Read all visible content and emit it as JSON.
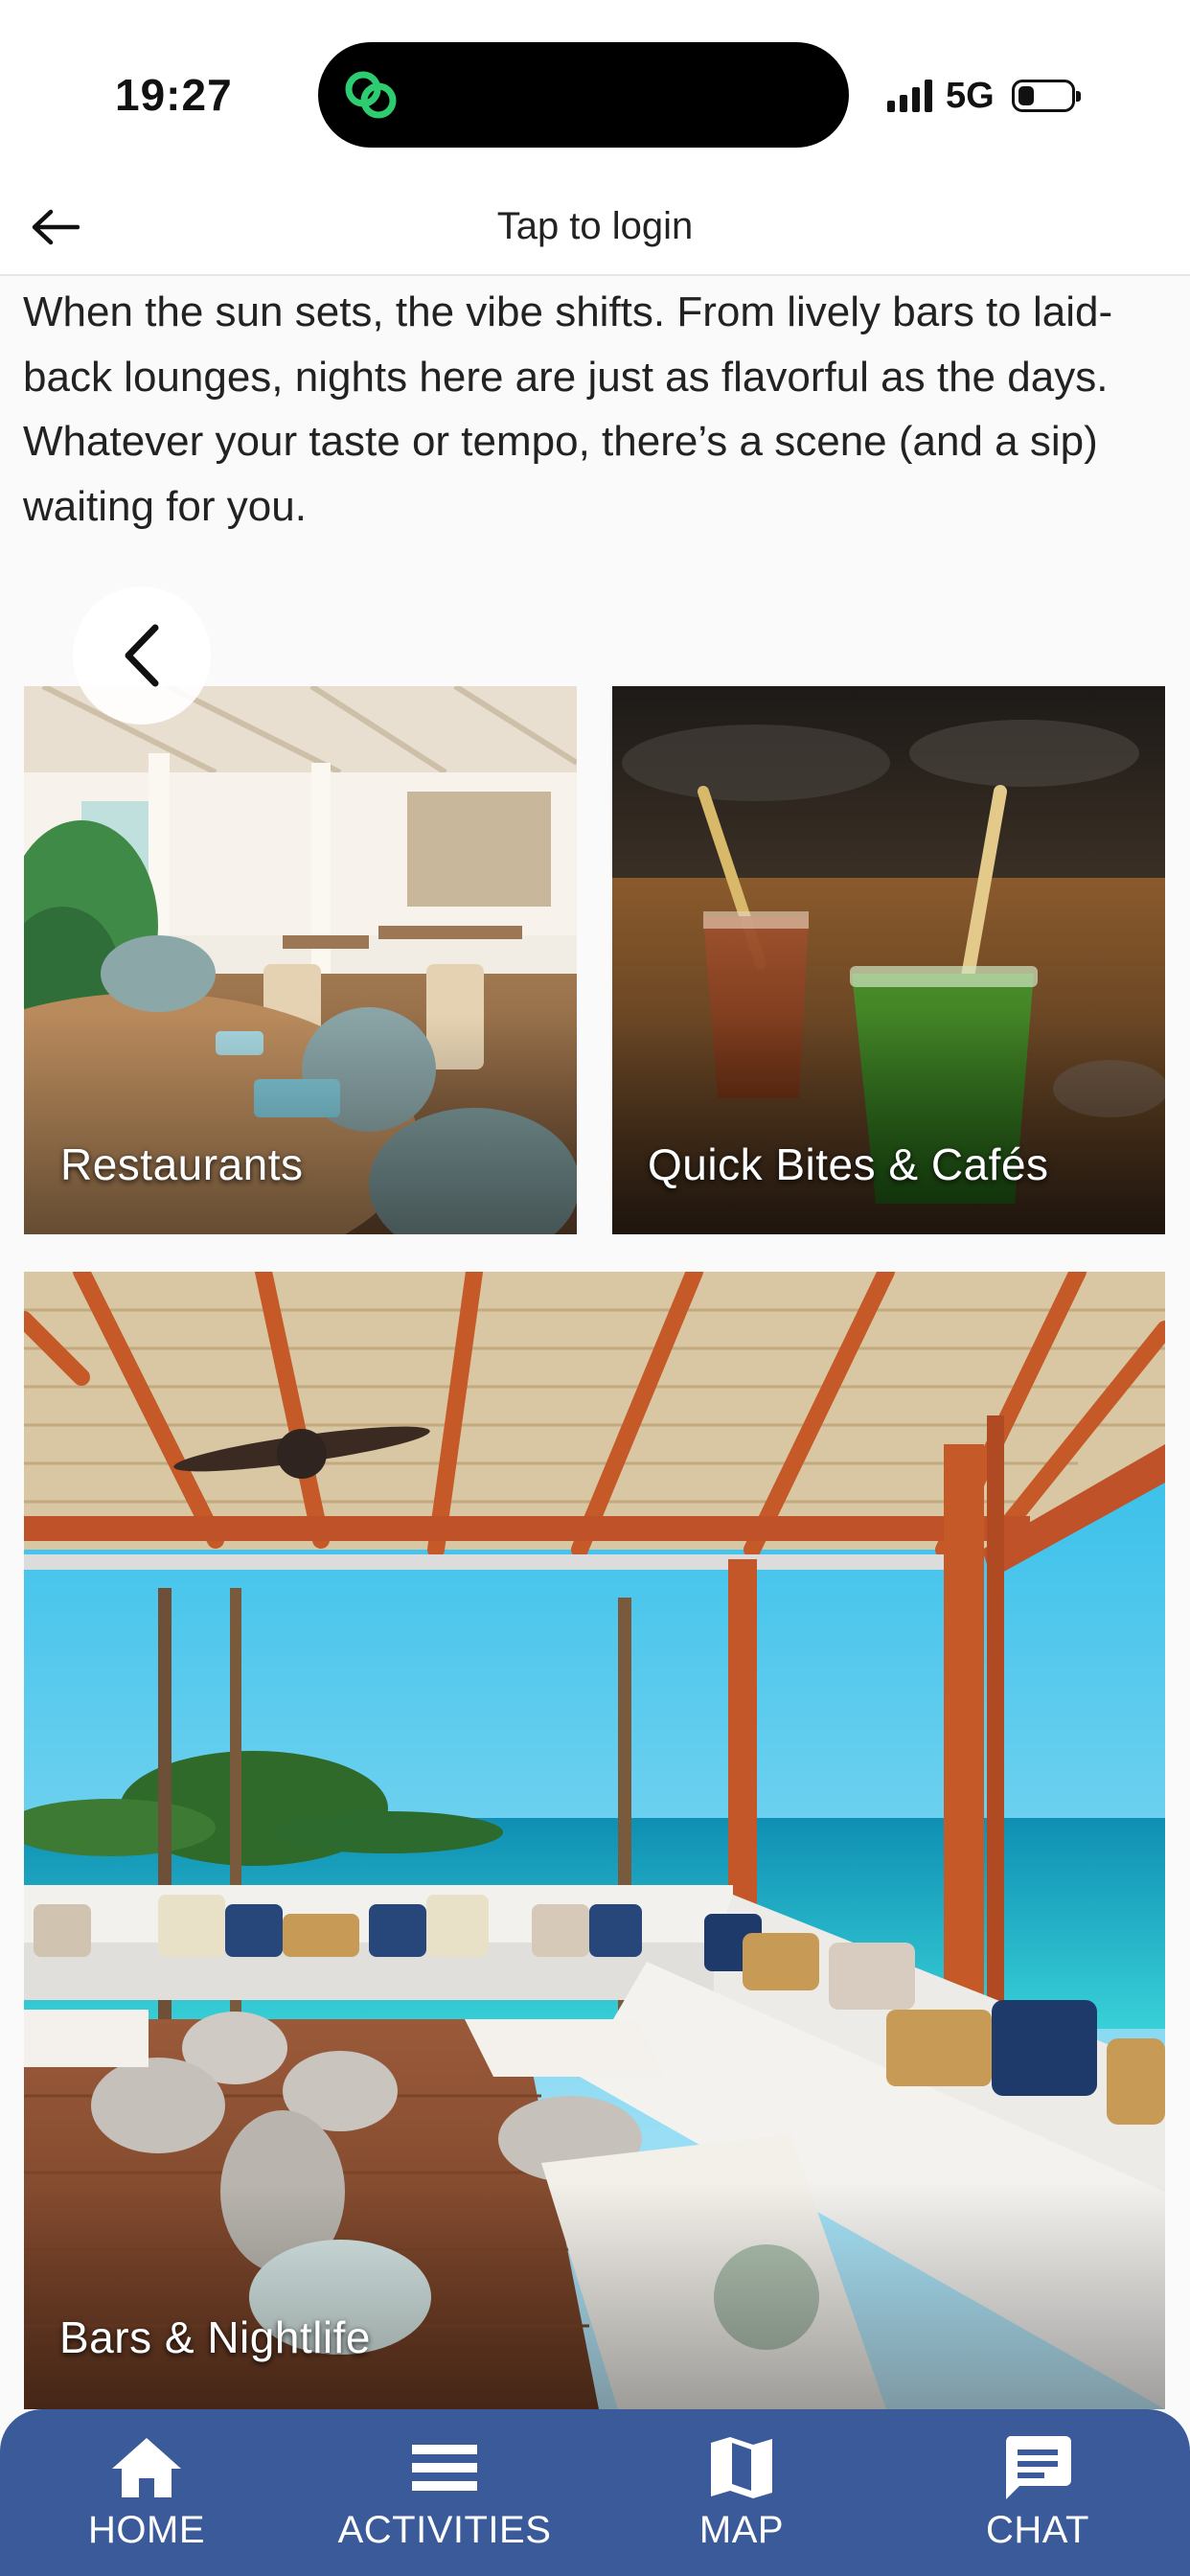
{
  "status_bar": {
    "time": "19:27",
    "network": "5G",
    "battery_level": 0.3,
    "app_icon": "link-chain-icon"
  },
  "header": {
    "back_icon": "arrow-left-icon",
    "title": "Tap to login"
  },
  "intro": {
    "text": "When the sun sets, the vibe shifts. From lively bars to laid-back lounges, nights here are just as flavorful as the days. Whatever your taste or tempo, there’s a scene (and a sip) waiting for you."
  },
  "carousel": {
    "prev_icon": "chevron-left-icon"
  },
  "tiles": [
    {
      "label": "Restaurants"
    },
    {
      "label": "Quick Bites & Cafés"
    },
    {
      "label": "Bars & Nightlife"
    }
  ],
  "bottom_nav": [
    {
      "label": "HOME",
      "icon": "home-icon"
    },
    {
      "label": "ACTIVITIES",
      "icon": "menu-icon"
    },
    {
      "label": "MAP",
      "icon": "map-icon"
    },
    {
      "label": "CHAT",
      "icon": "chat-icon"
    }
  ],
  "colors": {
    "nav_background": "#3b5a9a",
    "app_icon_green": "#2ecc71"
  }
}
